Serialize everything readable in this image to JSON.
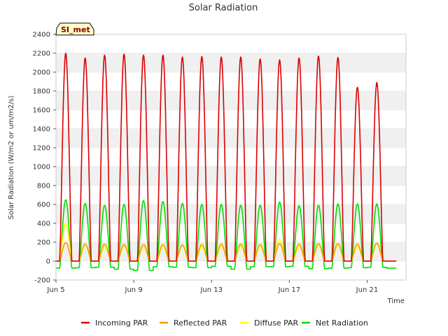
{
  "chart_data": {
    "type": "line",
    "title": "Solar Radiation",
    "xlabel": "Time",
    "ylabel": "Solar Radiation (W/m2 or um/m2/s)",
    "station_badge": "SI_met",
    "ylim": [
      -200,
      2400
    ],
    "yticks": [
      -200,
      0,
      200,
      400,
      600,
      800,
      1000,
      1200,
      1400,
      1600,
      1800,
      2000,
      2200,
      2400
    ],
    "xlim": [
      "2024-06-05",
      "2024-06-23"
    ],
    "xticks": [
      {
        "date": "2024-06-05",
        "label": "Jun 5"
      },
      {
        "date": "2024-06-09",
        "label": "Jun 9"
      },
      {
        "date": "2024-06-13",
        "label": "Jun 13"
      },
      {
        "date": "2024-06-17",
        "label": "Jun 17"
      },
      {
        "date": "2024-06-21",
        "label": "Jun 21"
      }
    ],
    "grid": "horizontal bands",
    "legend_position": "bottom",
    "days": [
      "2024-06-05",
      "2024-06-06",
      "2024-06-07",
      "2024-06-08",
      "2024-06-09",
      "2024-06-10",
      "2024-06-11",
      "2024-06-12",
      "2024-06-13",
      "2024-06-14",
      "2024-06-15",
      "2024-06-16",
      "2024-06-17",
      "2024-06-18",
      "2024-06-19",
      "2024-06-20",
      "2024-06-21",
      "2024-06-22"
    ],
    "series": [
      {
        "name": "Incoming PAR",
        "color": "#dd0000",
        "daily_peak": [
          2200,
          2150,
          2180,
          2190,
          2180,
          2180,
          2160,
          2165,
          2160,
          2160,
          2140,
          2130,
          2150,
          2170,
          2155,
          1840,
          1890,
          0
        ],
        "night_value": 0
      },
      {
        "name": "Reflected PAR",
        "color": "#ff9900",
        "daily_peak": [
          195,
          180,
          180,
          175,
          175,
          175,
          170,
          175,
          180,
          180,
          175,
          185,
          180,
          185,
          185,
          180,
          190,
          0
        ],
        "night_value": 0
      },
      {
        "name": "Diffuse PAR",
        "color": "#ffff00",
        "daily_peak": [
          400,
          170,
          160,
          160,
          150,
          150,
          160,
          150,
          160,
          160,
          160,
          230,
          160,
          170,
          170,
          150,
          180,
          0
        ],
        "night_value": 0
      },
      {
        "name": "Net Radiation",
        "color": "#00dd00",
        "daily_peak": [
          650,
          610,
          590,
          600,
          640,
          630,
          610,
          600,
          600,
          590,
          590,
          625,
          585,
          590,
          605,
          605,
          605,
          0
        ],
        "night_value": [
          -75,
          -70,
          -65,
          -85,
          -100,
          -60,
          -65,
          -70,
          -55,
          -85,
          -60,
          -60,
          -55,
          -80,
          -75,
          -70,
          -65,
          -75
        ]
      }
    ]
  }
}
